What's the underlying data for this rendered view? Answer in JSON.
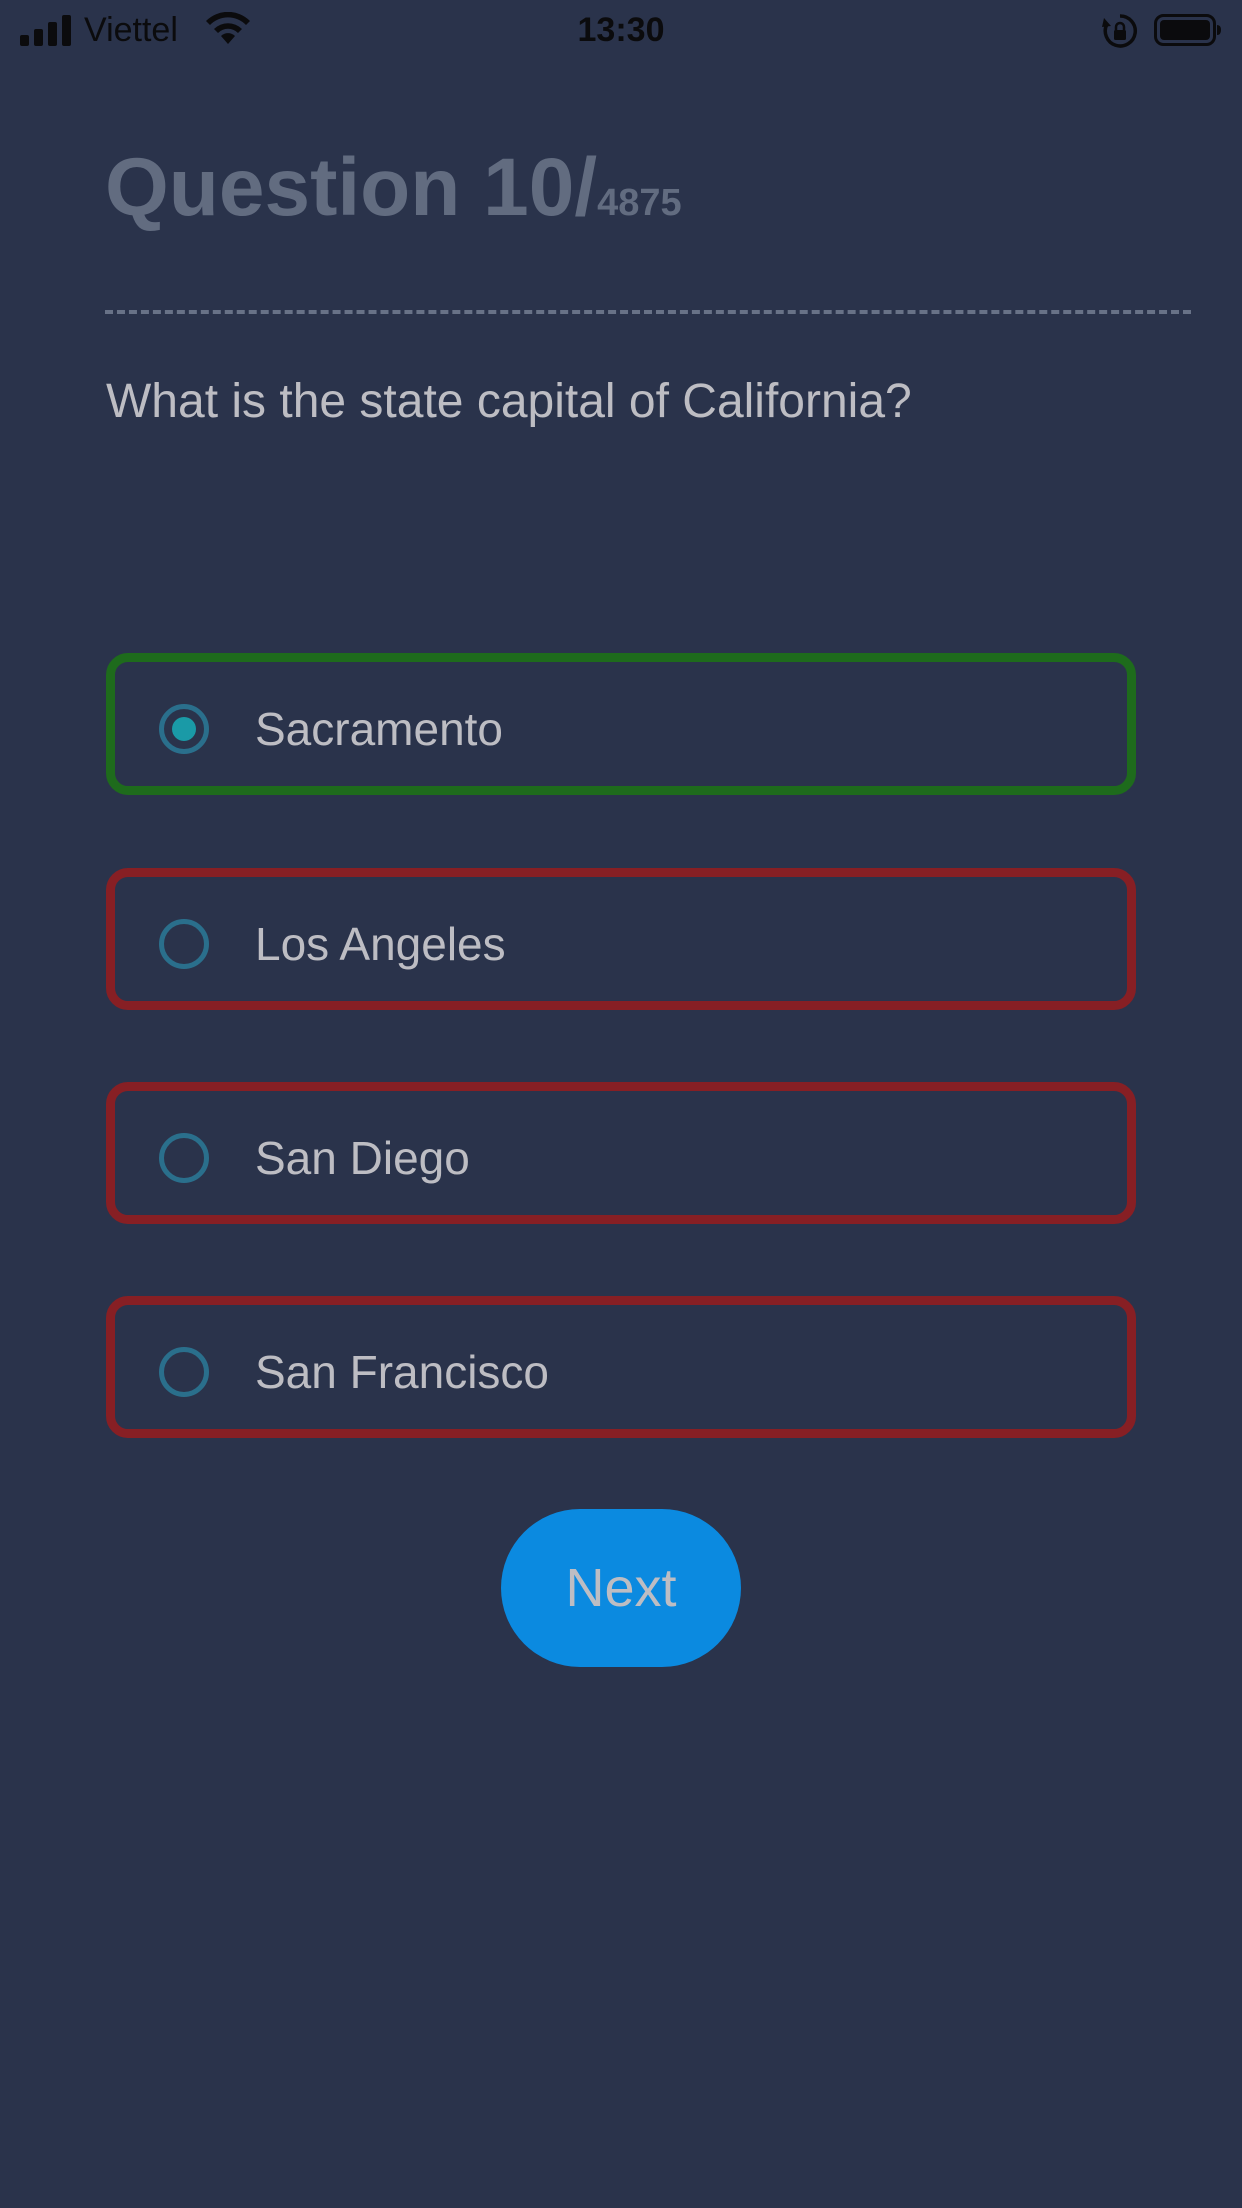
{
  "status_bar": {
    "carrier": "Viettel",
    "time": "13:30"
  },
  "header": {
    "question_label": "Question 10/",
    "question_total": "4875"
  },
  "question": {
    "text": "What is the state capital of California?"
  },
  "answers": [
    {
      "label": "Sacramento",
      "selected": true,
      "status": "correct"
    },
    {
      "label": "Los Angeles",
      "selected": false,
      "status": "incorrect"
    },
    {
      "label": "San Diego",
      "selected": false,
      "status": "incorrect"
    },
    {
      "label": "San Francisco",
      "selected": false,
      "status": "incorrect"
    }
  ],
  "next_button": {
    "label": "Next"
  },
  "colors": {
    "background": "#2a334b",
    "correct_border": "#1e6b1c",
    "incorrect_border": "#871f24",
    "button": "#0b8ae0",
    "radio": "#2a6f8c",
    "radio_selected": "#1a9aa7"
  },
  "icons": {
    "signal": "cellular-signal-icon",
    "wifi": "wifi-icon",
    "orientation_lock": "orientation-lock-icon",
    "battery": "battery-icon"
  }
}
